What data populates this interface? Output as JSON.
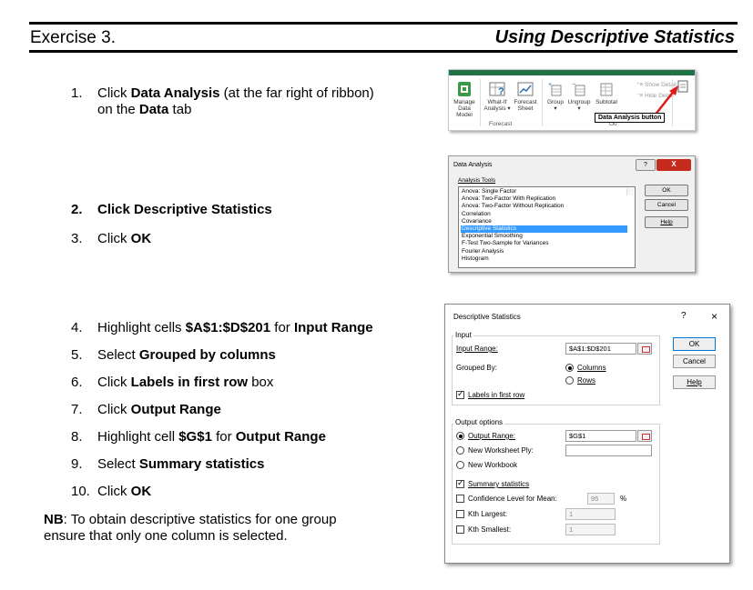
{
  "header": {
    "left": "Exercise 3.",
    "right": "Using Descriptive Statistics"
  },
  "steps": [
    {
      "num": "1.",
      "parts": [
        {
          "t": "Click "
        },
        {
          "b": "Data Analysis"
        },
        {
          "t": " (at the far right of ribbon)"
        }
      ],
      "line2": [
        {
          "t": "on the "
        },
        {
          "b": "Data"
        },
        {
          "t": " tab"
        }
      ]
    },
    {
      "num": "2.",
      "parts": [
        {
          "b": "Click Descriptive Statistics"
        }
      ]
    },
    {
      "num": "3.",
      "parts": [
        {
          "t": "Click "
        },
        {
          "b": "OK"
        }
      ]
    },
    {
      "num": "4.",
      "parts": [
        {
          "t": "Highlight cells "
        },
        {
          "b": "$A$1:$D$201"
        },
        {
          "t": " for "
        },
        {
          "b": "Input Range"
        }
      ]
    },
    {
      "num": "5.",
      "parts": [
        {
          "t": "Select "
        },
        {
          "b": "Grouped by columns"
        }
      ]
    },
    {
      "num": "6.",
      "parts": [
        {
          "t": "Click "
        },
        {
          "b": "Labels in first row"
        },
        {
          "t": " box"
        }
      ]
    },
    {
      "num": "7.",
      "parts": [
        {
          "t": "Click "
        },
        {
          "b": "Output Range"
        }
      ]
    },
    {
      "num": "8.",
      "parts": [
        {
          "t": "Highlight cell "
        },
        {
          "b": "$G$1"
        },
        {
          "t": " for "
        },
        {
          "b": "Output Range"
        }
      ]
    },
    {
      "num": "9.",
      "parts": [
        {
          "t": "Select "
        },
        {
          "b": "Summary statistics"
        }
      ]
    },
    {
      "num": "10.",
      "parts": [
        {
          "t": "Click "
        },
        {
          "b": "OK"
        }
      ]
    }
  ],
  "nb": {
    "label": "NB",
    "line1": ": To obtain descriptive statistics for one group",
    "line2": "ensure that only one column is selected."
  },
  "ribbon": {
    "manage": [
      "Manage",
      "Data Model"
    ],
    "whatif": [
      "What-If",
      "Analysis ▾"
    ],
    "forecast": [
      "Forecast",
      "Sheet"
    ],
    "group": "Group",
    "ungroup": "Ungroup",
    "subtotal": "Subtotal",
    "show_detail": "Show Detail",
    "hide_detail": "Hide Detail",
    "forecast_group": "Forecast",
    "outline_group": "Ou",
    "callout": "Data Analysis button",
    "colors": {
      "excel_green": "#217346",
      "arrow": "#e01b1b"
    }
  },
  "data_analysis": {
    "title": "Data Analysis",
    "tools_label": "Analysis Tools",
    "items": [
      "Anova: Single Factor",
      "Anova: Two-Factor With Replication",
      "Anova: Two-Factor Without Replication",
      "Correlation",
      "Covariance",
      "Descriptive Statistics",
      "Exponential Smoothing",
      "F-Test Two-Sample for Variances",
      "Fourier Analysis",
      "Histogram"
    ],
    "selected_index": 5,
    "ok": "OK",
    "cancel": "Cancel",
    "help": "Help",
    "help_glyph": "?",
    "close_glyph": "X"
  },
  "descriptive_stats": {
    "title": "Descriptive Statistics",
    "help_glyph": "?",
    "close_glyph": "×",
    "input_group": "Input",
    "input_range_label": "Input Range:",
    "input_range_value": "$A$1:$D$201",
    "grouped_by_label": "Grouped By:",
    "columns": "Columns",
    "rows": "Rows",
    "labels_first_row": "Labels in first row",
    "output_group": "Output options",
    "output_range": "Output Range:",
    "output_range_value": "$G$1",
    "new_worksheet": "New Worksheet Ply:",
    "new_workbook": "New Workbook",
    "summary_stats": "Summary statistics",
    "confidence": "Confidence Level for Mean:",
    "confidence_value": "95",
    "percent": "%",
    "kth_largest": "Kth Largest:",
    "kth_largest_value": "1",
    "kth_smallest": "Kth Smallest:",
    "kth_smallest_value": "1",
    "ok": "OK",
    "cancel": "Cancel",
    "help": "Help"
  }
}
